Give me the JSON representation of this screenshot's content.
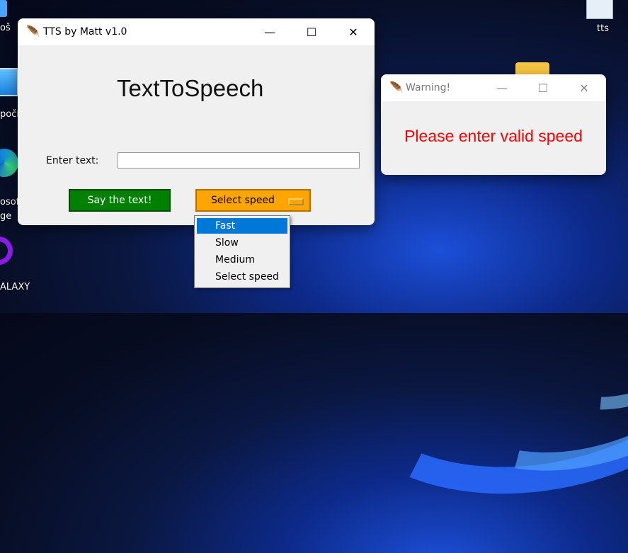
{
  "desktop": {
    "icons": [
      {
        "label": "oš",
        "icon": "folder-icon"
      },
      {
        "label": "počí",
        "icon": "computer-icon"
      },
      {
        "label": "osoft\nge",
        "icon": "edge-icon"
      },
      {
        "label": "ALAXY",
        "icon": "circle-app-icon"
      },
      {
        "label": "tts",
        "icon": "file-icon"
      }
    ]
  },
  "main_window": {
    "title": "TTS by Matt v1.0",
    "heading": "TextToSpeech",
    "text_label": "Enter text:",
    "text_value": "",
    "say_button": "Say the text!",
    "speed_select": "Select speed",
    "controls": {
      "minimize": "—",
      "maximize": "☐",
      "close": "✕"
    }
  },
  "dropdown": {
    "options": [
      "Fast",
      "Slow",
      "Medium",
      "Select speed"
    ],
    "highlighted": "Fast"
  },
  "warning_window": {
    "title": "Warning!",
    "message": "Please enter valid speed",
    "controls": {
      "minimize": "—",
      "maximize": "☐",
      "close": "✕"
    }
  },
  "colors": {
    "say_button_bg": "#008000",
    "select_bg": "#ffa500",
    "warning_text": "#ff0000",
    "highlight": "#0078d7"
  }
}
